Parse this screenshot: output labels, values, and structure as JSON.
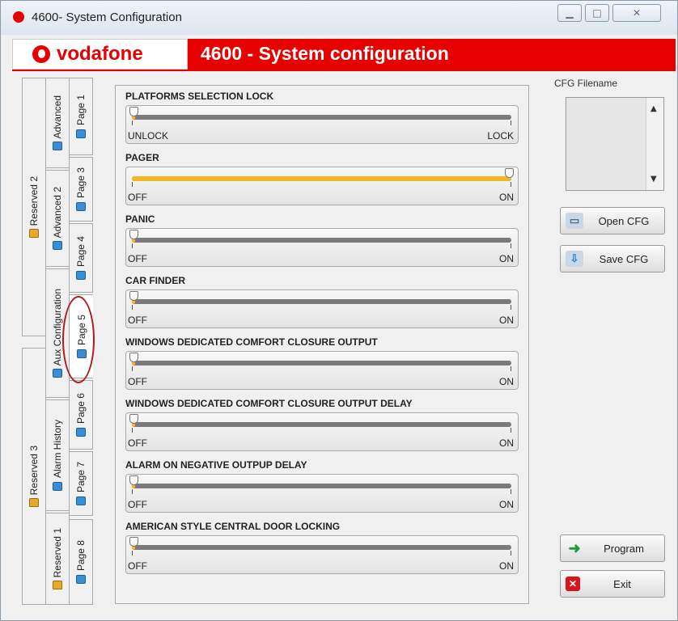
{
  "window": {
    "title": "4600-  System Configuration"
  },
  "header": {
    "brand": "vodafone",
    "title": "4600 - System configuration",
    "color": "#e60000"
  },
  "tabs": {
    "col1": [
      {
        "label": "Reserved 2"
      },
      {
        "label": "Reserved 3"
      }
    ],
    "col2": [
      {
        "label": "Advanced"
      },
      {
        "label": "Advanced 2"
      },
      {
        "label": "Aux Configuration"
      },
      {
        "label": "Alarm History"
      },
      {
        "label": "Reserved 1"
      }
    ],
    "col3": [
      {
        "label": "Page 1"
      },
      {
        "label": "Page 3"
      },
      {
        "label": "Page 4"
      },
      {
        "label": "Page 5"
      },
      {
        "label": "Page 6"
      },
      {
        "label": "Page 7"
      },
      {
        "label": "Page 8"
      }
    ],
    "active": "Page 5"
  },
  "settings": [
    {
      "title": "PLATFORMS SELECTION LOCK",
      "left_label": "UNLOCK",
      "right_label": "LOCK",
      "value": 0
    },
    {
      "title": "PAGER",
      "left_label": "OFF",
      "right_label": "ON",
      "value": 1
    },
    {
      "title": "PANIC",
      "left_label": "OFF",
      "right_label": "ON",
      "value": 0
    },
    {
      "title": "CAR FINDER",
      "left_label": "OFF",
      "right_label": "ON",
      "value": 0
    },
    {
      "title": "WINDOWS DEDICATED COMFORT CLOSURE OUTPUT",
      "left_label": "OFF",
      "right_label": "ON",
      "value": 0
    },
    {
      "title": "WINDOWS DEDICATED COMFORT CLOSURE OUTPUT DELAY",
      "left_label": "OFF",
      "right_label": "ON",
      "value": 0
    },
    {
      "title": "ALARM ON NEGATIVE OUTPUP DELAY",
      "left_label": "OFF",
      "right_label": "ON",
      "value": 0
    },
    {
      "title": "AMERICAN STYLE CENTRAL DOOR LOCKING",
      "left_label": "OFF",
      "right_label": "ON",
      "value": 0
    }
  ],
  "cfg": {
    "label": "CFG Filename",
    "open_label": "Open CFG",
    "save_label": "Save CFG",
    "program_label": "Program",
    "exit_label": "Exit"
  },
  "icons": {
    "tab": "toolbox-icon",
    "locked_tab": "padlock-icon",
    "open": "folder-open-icon",
    "save": "folder-save-icon",
    "program": "green-arrow-icon",
    "exit": "red-x-icon"
  },
  "colors": {
    "accent": "#f3b625",
    "track": "#7a7a7a",
    "exit_red": "#d9141b"
  }
}
